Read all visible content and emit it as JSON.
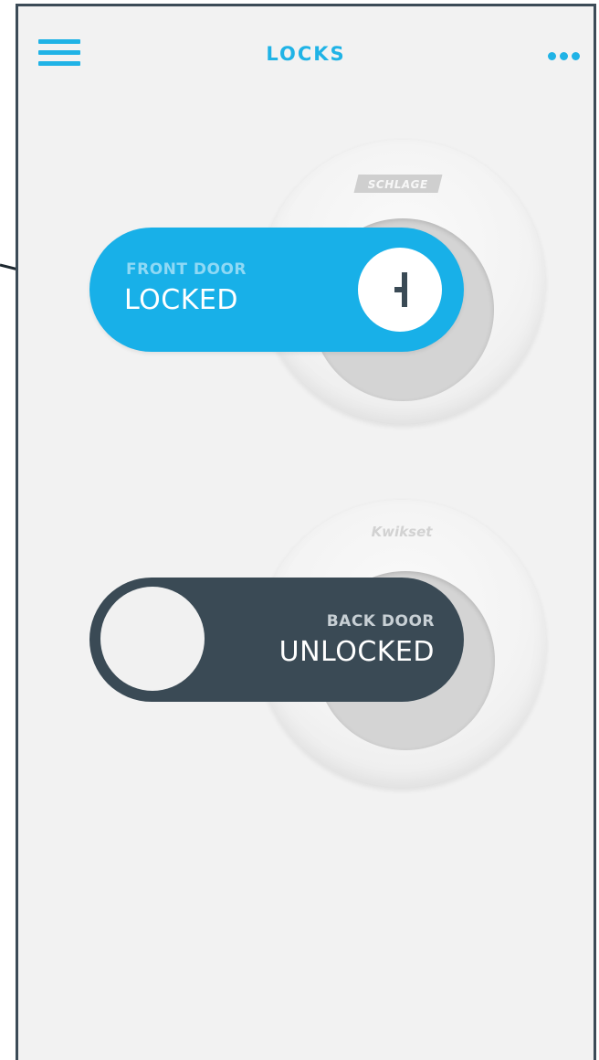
{
  "header": {
    "title": "LOCKS",
    "menu_icon": "hamburger-menu-icon",
    "more_icon": "more-dots-icon"
  },
  "locks": [
    {
      "brand": "SCHLAGE",
      "name": "FRONT DOOR",
      "status": "LOCKED",
      "is_locked": true,
      "status_icon": "keyhole-icon"
    },
    {
      "brand": "Kwikset",
      "name": "BACK DOOR",
      "status": "UNLOCKED",
      "is_locked": false
    }
  ],
  "colors": {
    "accent": "#18b0e8",
    "dark": "#3a4a55",
    "frame": "#3c4b57",
    "background": "#f2f2f2"
  }
}
